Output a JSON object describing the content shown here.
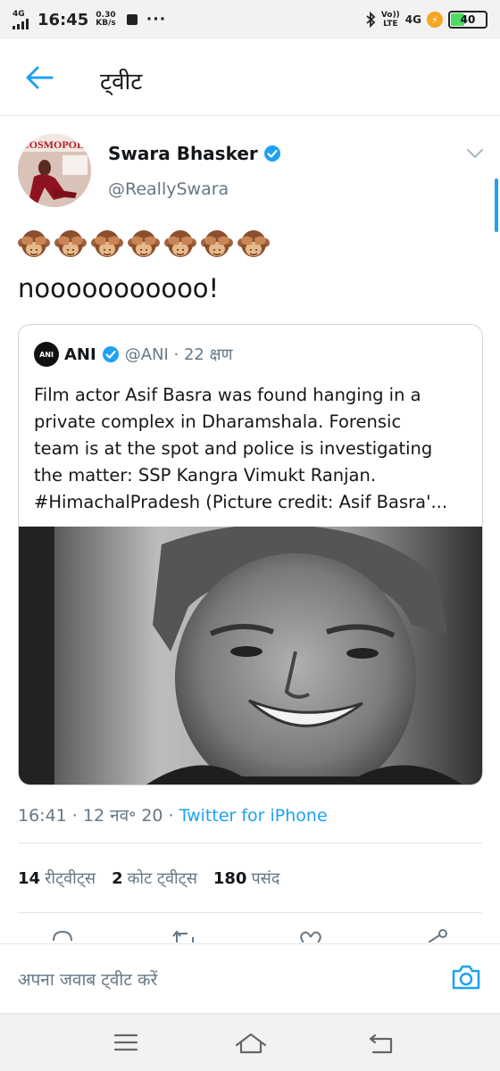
{
  "status_bar": {
    "network": "4G",
    "time": "16:45",
    "speed_value": "0.30",
    "speed_unit": "KB/s",
    "dots": "···",
    "volte_line1": "Vo))",
    "volte_line2": "LTE",
    "network_right": "4G",
    "battery": "40"
  },
  "header": {
    "title": "ट्वीट"
  },
  "tweet": {
    "author_name": "Swara Bhasker",
    "author_handle": "@ReallySwara",
    "emoji_count": 7,
    "text": "nooooooooooo!",
    "timestamp": "16:41 · 12 नव॰ 20 · ",
    "source": "Twitter for iPhone"
  },
  "quote": {
    "logo": "ANI",
    "name": "ANI",
    "handle_time": "@ANI · 22 क्षण",
    "lines": [
      "Film actor Asif Basra was found hanging in a",
      "private complex in Dharamshala. Forensic",
      "team is at the spot and police is investigating",
      "the matter: SSP Kangra Vimukt Ranjan.",
      "#HimachalPradesh (Picture credit: Asif Basra'..."
    ]
  },
  "stats": {
    "retweets_count": "14",
    "retweets_label": "रीट्वीट्स",
    "quotes_count": "2",
    "quotes_label": "कोट ट्वीट्स",
    "likes_count": "180",
    "likes_label": "पसंद"
  },
  "reply": {
    "placeholder": "अपना जवाब ट्वीट करें"
  },
  "colors": {
    "accent": "#1da1f2",
    "secondary_text": "#657786",
    "primary_text": "#14171a",
    "divider": "#e1e8ed"
  },
  "icons": [
    "back-arrow-icon",
    "verified-badge-icon",
    "chevron-down-icon",
    "see-no-evil-monkey-emoji",
    "reply-icon",
    "retweet-icon",
    "like-icon",
    "share-icon",
    "camera-icon",
    "menu-icon",
    "home-icon",
    "back-icon"
  ]
}
